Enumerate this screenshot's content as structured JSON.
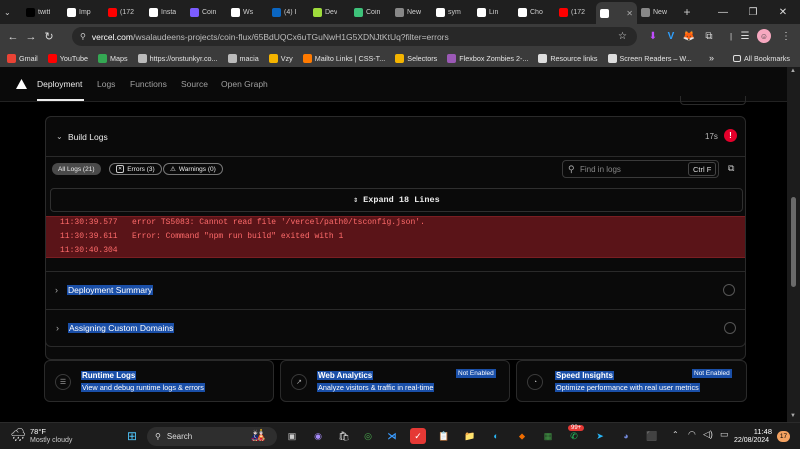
{
  "browser": {
    "tabs": [
      {
        "label": "twitt",
        "icon": "x-icon",
        "color": "#000000"
      },
      {
        "label": "Imp",
        "icon": "notion-icon",
        "color": "#ffffff"
      },
      {
        "label": "(172",
        "icon": "youtube-icon",
        "color": "#ff0000"
      },
      {
        "label": "Insta",
        "icon": "instapaper-icon",
        "color": "#ffffff"
      },
      {
        "label": "Coin",
        "icon": "coin-icon",
        "color": "#7b5cff"
      },
      {
        "label": "Ws",
        "icon": "github-icon",
        "color": "#ffffff"
      },
      {
        "label": "(4) I",
        "icon": "linkedin-icon",
        "color": "#0a66c2"
      },
      {
        "label": "Dev",
        "icon": "dev-icon",
        "color": "#9fdc3c"
      },
      {
        "label": "Coin",
        "icon": "coin-icon",
        "color": "#3ec27a"
      },
      {
        "label": "New",
        "icon": "new-icon",
        "color": "#888888"
      },
      {
        "label": "sym",
        "icon": "google-icon",
        "color": "#ffffff"
      },
      {
        "label": "Lin",
        "icon": "instapaper-icon",
        "color": "#ffffff"
      },
      {
        "label": "Cho",
        "icon": "github-icon",
        "color": "#ffffff"
      },
      {
        "label": "(172",
        "icon": "youtube-icon",
        "color": "#ff0000"
      },
      {
        "label": "",
        "icon": "vercel-icon",
        "color": "#ffffff",
        "active": true
      },
      {
        "label": "New",
        "icon": "new-icon",
        "color": "#888888"
      }
    ],
    "new_tab": "+",
    "url_host": "vercel.com",
    "url_rest": "/wsalaudeens-projects/coin-flux/65BdUQCx6uTGuNwH1G5XDNJtKtUq?filter=errors",
    "bookmarks": [
      {
        "label": "Gmail",
        "icon": "gmail-icon",
        "color": "#ea4335"
      },
      {
        "label": "YouTube",
        "icon": "youtube-icon",
        "color": "#ff0000"
      },
      {
        "label": "Maps",
        "icon": "maps-icon",
        "color": "#34a853"
      },
      {
        "label": "https://onstunkyr.co...",
        "icon": "globe-icon",
        "color": "#bbbbbb"
      },
      {
        "label": "macia",
        "icon": "globe-icon",
        "color": "#bbbbbb"
      },
      {
        "label": "Vzy",
        "icon": "vzy-icon",
        "color": "#f4b400"
      },
      {
        "label": "Mailto Links | CSS-T...",
        "icon": "star-icon",
        "color": "#ff7a00"
      },
      {
        "label": "Selectors",
        "icon": "selector-icon",
        "color": "#f4b400"
      },
      {
        "label": "Flexbox Zombies 2-...",
        "icon": "zombie-icon",
        "color": "#9b59b6"
      },
      {
        "label": "Resource links",
        "icon": "folder-icon",
        "color": "#dddddd"
      },
      {
        "label": "Screen Readers – W...",
        "icon": "w-icon",
        "color": "#dddddd"
      }
    ],
    "more": "»",
    "all_bookmarks": "All Bookmarks"
  },
  "vercel": {
    "tabs": [
      "Deployment",
      "Logs",
      "Functions",
      "Source",
      "Open Graph"
    ],
    "build_logs": {
      "title": "Build Logs",
      "duration": "17s",
      "filters": {
        "all": "All Logs (21)",
        "errors": "Errors (3)",
        "warnings": "Warnings (0)"
      },
      "search_placeholder": "Find in logs",
      "shortcut": "Ctrl F",
      "expand": "Expand 18 Lines",
      "lines": [
        {
          "time": "11:30:39.577",
          "msg": "error TS5083: Cannot read file '/vercel/path0/tsconfig.json'."
        },
        {
          "time": "11:30:39.611",
          "msg": "Error: Command \"npm run build\" exited with 1"
        },
        {
          "time": "11:30:40.304",
          "msg": ""
        }
      ]
    },
    "sections": [
      "Deployment Summary",
      "Assigning Custom Domains"
    ],
    "features": [
      {
        "title": "Runtime Logs",
        "desc": "View and debug runtime logs & errors",
        "badge": ""
      },
      {
        "title": "Web Analytics",
        "desc": "Analyze visitors & traffic in real-time",
        "badge": "Not Enabled"
      },
      {
        "title": "Speed Insights",
        "desc": "Optimize performance with real user metrics",
        "badge": "Not Enabled"
      }
    ]
  },
  "taskbar": {
    "weather_temp": "78°F",
    "weather_desc": "Mostly cloudy",
    "search": "Search",
    "time": "11:48",
    "date": "22/08/2024",
    "whatsapp_badge": "99+",
    "notification_count": "17"
  }
}
